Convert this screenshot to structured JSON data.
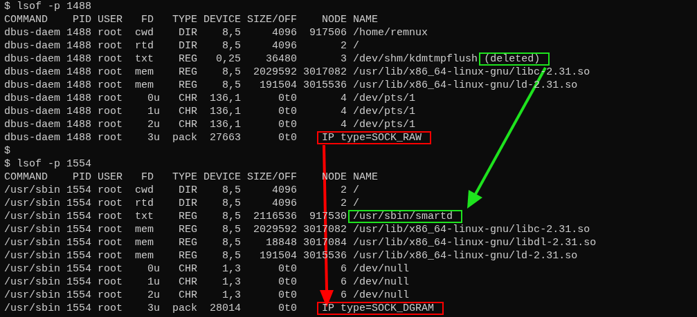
{
  "lines": [
    {
      "text": "$ lsof -p 1488"
    },
    {
      "text": "COMMAND    PID USER   FD   TYPE DEVICE SIZE/OFF    NODE NAME"
    },
    {
      "text": "dbus-daem 1488 root  cwd    DIR    8,5     4096  917506 /home/remnux"
    },
    {
      "text": "dbus-daem 1488 root  rtd    DIR    8,5     4096       2 /"
    },
    {
      "text": "dbus-daem 1488 root  txt    REG   0,25    36480       3 /dev/shm/kdmtmpflush ",
      "highlight": {
        "text": "(deleted)",
        "color": "#1ee31e"
      }
    },
    {
      "text": "dbus-daem 1488 root  mem    REG    8,5  2029592 3017082 /usr/lib/x86_64-linux-gnu/libc-2.31.so"
    },
    {
      "text": "dbus-daem 1488 root  mem    REG    8,5   191504 3015536 /usr/lib/x86_64-linux-gnu/ld-2.31.so"
    },
    {
      "text": "dbus-daem 1488 root    0u   CHR  136,1      0t0       4 /dev/pts/1"
    },
    {
      "text": "dbus-daem 1488 root    1u   CHR  136,1      0t0       4 /dev/pts/1"
    },
    {
      "text": "dbus-daem 1488 root    2u   CHR  136,1      0t0       4 /dev/pts/1"
    },
    {
      "text": "dbus-daem 1488 root    3u  pack  27663      0t0    ",
      "highlight": {
        "text": "IP type=SOCK_RAW",
        "color": "#ff0000"
      }
    },
    {
      "text": "$"
    },
    {
      "text": "$ lsof -p 1554"
    },
    {
      "text": "COMMAND    PID USER   FD   TYPE DEVICE SIZE/OFF    NODE NAME"
    },
    {
      "text": "/usr/sbin 1554 root  cwd    DIR    8,5     4096       2 /"
    },
    {
      "text": "/usr/sbin 1554 root  rtd    DIR    8,5     4096       2 /"
    },
    {
      "text": "/usr/sbin 1554 root  txt    REG    8,5  2116536  917530 ",
      "highlight": {
        "text": "/usr/sbin/smartd",
        "color": "#1ee31e"
      }
    },
    {
      "text": "/usr/sbin 1554 root  mem    REG    8,5  2029592 3017082 /usr/lib/x86_64-linux-gnu/libc-2.31.so"
    },
    {
      "text": "/usr/sbin 1554 root  mem    REG    8,5    18848 3017084 /usr/lib/x86_64-linux-gnu/libdl-2.31.so"
    },
    {
      "text": "/usr/sbin 1554 root  mem    REG    8,5   191504 3015536 /usr/lib/x86_64-linux-gnu/ld-2.31.so"
    },
    {
      "text": "/usr/sbin 1554 root    0u   CHR    1,3      0t0       6 /dev/null"
    },
    {
      "text": "/usr/sbin 1554 root    1u   CHR    1,3      0t0       6 /dev/null"
    },
    {
      "text": "/usr/sbin 1554 root    2u   CHR    1,3      0t0       6 /dev/null"
    },
    {
      "text": "/usr/sbin 1554 root    3u  pack  28014      0t0    ",
      "highlight": {
        "text": "IP type=SOCK_DGRAM",
        "color": "#ff0000"
      }
    }
  ],
  "arrows": [
    {
      "kind": "down",
      "color": "#ff0000"
    },
    {
      "kind": "diagonal",
      "color": "#1ee31e"
    }
  ]
}
